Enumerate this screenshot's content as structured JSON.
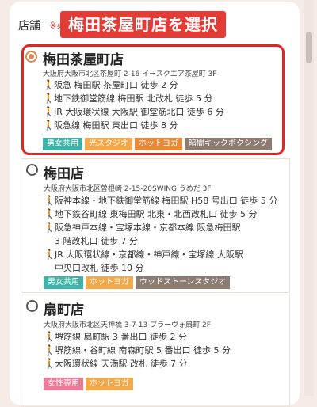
{
  "header": {
    "label": "店舗",
    "note": "※必",
    "callout": "梅田茶屋町店を選択"
  },
  "stores": [
    {
      "name": "梅田茶屋町店",
      "selected": true,
      "address": "大阪府大阪市北区茶屋町 2-16 イースクエア茶屋町 3F",
      "access": [
        "阪急 梅田駅 茶屋町口 徒歩 2 分",
        "地下鉄御堂筋線 梅田駅 北改札 徒歩 5 分",
        "JR 大阪環状線 大阪駅 御堂筋北口 徒歩 6 分",
        "阪急線 梅田駅 東出口 徒歩 8 分"
      ],
      "tags": [
        {
          "label": "男女共用",
          "color": "#3fb3a8"
        },
        {
          "label": "光スタジオ",
          "color": "#f3a94b"
        },
        {
          "label": "ホットヨガ",
          "color": "#e68a3a"
        },
        {
          "label": "暗闇キックボクシング",
          "color": "#8b7b70"
        }
      ]
    },
    {
      "name": "梅田店",
      "selected": false,
      "address": "大阪府大阪市北区曽根崎 2-15-20SWING うめだ 3F",
      "access": [
        "阪神本線・地下鉄御堂筋線 梅田駅 H58 号出口 徒歩 5 分",
        "地下鉄谷町線 東梅田駅 北東・北西改札口 徒歩 5 分",
        "阪急神戸本線・宝塚本線・京都本線 阪急梅田駅",
        "3 階改札口 徒歩 7 分",
        "JR 大阪環状線・京都線・神戸線・宝塚線 大阪駅",
        "中央口改札 徒歩 10 分"
      ],
      "tags": [
        {
          "label": "男女共用",
          "color": "#3fb3a8"
        },
        {
          "label": "ホットヨガ",
          "color": "#f3a94b"
        },
        {
          "label": "ウッドストーンスタジオ",
          "color": "#8b7b70"
        }
      ]
    },
    {
      "name": "扇町店",
      "selected": false,
      "address": "大阪府大阪市北区天神橋 3-7-13 ブラーヴォ扇町 2F",
      "access": [
        "堺筋線 扇町駅 3 番出口 徒歩 2 分",
        "堺筋線・谷町線 南森町駅 5 番出口 徒歩 5 分",
        "大阪環状線 天満駅 改札 徒歩 7 分"
      ],
      "tags": [
        {
          "label": "女性専用",
          "color": "#ef7a96"
        },
        {
          "label": "ホットヨガ",
          "color": "#f3a94b"
        }
      ]
    }
  ]
}
